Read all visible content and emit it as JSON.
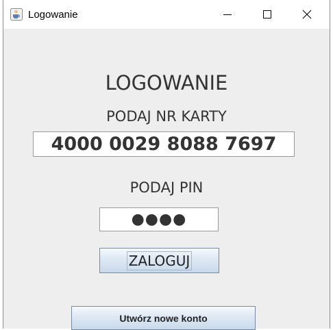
{
  "window": {
    "title": "Logowanie"
  },
  "form": {
    "heading": "LOGOWANIE",
    "card_label": "PODAJ NR KARTY",
    "card_value": "4000 0029 8088 7697",
    "pin_label": "PODAJ PIN",
    "pin_value": "●●●●",
    "login_button": "ZALOGUJ",
    "create_account_button": "Utwórz nowe konto"
  },
  "icons": {
    "app": "java-cup-icon",
    "minimize": "minimize-icon",
    "maximize": "maximize-icon",
    "close": "close-icon"
  }
}
